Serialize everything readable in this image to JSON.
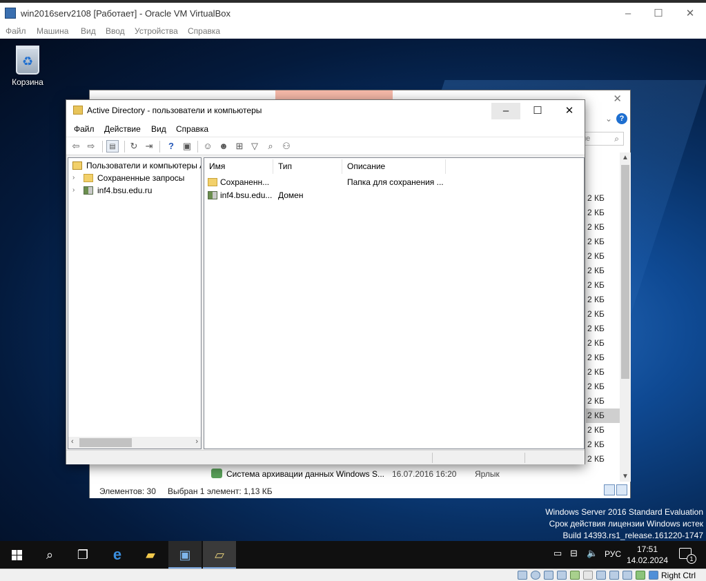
{
  "vbox": {
    "title": "win2016serv2108 [Работает] - Oracle VM VirtualBox",
    "menu": [
      "Файл",
      "Машина",
      "Вид",
      "Ввод",
      "Устройства",
      "Справка"
    ],
    "controls": {
      "minimize": "–",
      "maximize": "☐",
      "close": "✕"
    },
    "host_key": "Right Ctrl"
  },
  "desktop": {
    "recycle_bin_label": "Корзина"
  },
  "explorer_bg": {
    "search_placeholder": "ие",
    "sizes": [
      "2 КБ",
      "2 КБ",
      "2 КБ",
      "2 КБ",
      "2 КБ",
      "2 КБ",
      "2 КБ",
      "2 КБ",
      "2 КБ",
      "2 КБ",
      "2 КБ",
      "2 КБ",
      "2 КБ",
      "2 КБ",
      "2 КБ",
      "2 КБ",
      "2 КБ",
      "2 КБ",
      "2 КБ"
    ],
    "selected_size_index": 15,
    "visible_row": {
      "name": "Система архивации данных Windows S...",
      "date": "16.07.2016 16:20",
      "type": "Ярлык"
    },
    "status": {
      "count": "Элементов: 30",
      "selection": "Выбран 1 элемент: 1,13 КБ"
    }
  },
  "ad": {
    "title": "Active Directory - пользователи и компьютеры",
    "menu": [
      "Файл",
      "Действие",
      "Вид",
      "Справка"
    ],
    "tree": {
      "root": "Пользователи и компьютеры Active Directory",
      "children": [
        "Сохраненные запросы",
        "inf4.bsu.edu.ru"
      ]
    },
    "columns": [
      "Имя",
      "Тип",
      "Описание"
    ],
    "rows": [
      {
        "name": "Сохраненн...",
        "type": "",
        "description": "Папка для сохранения ...",
        "icon": "folder-icon"
      },
      {
        "name": "inf4.bsu.edu...",
        "type": "Домен",
        "description": "",
        "icon": "domain-icon"
      }
    ]
  },
  "watermark": {
    "line1": "Windows Server 2016 Standard Evaluation",
    "line2": "Срок действия лицензии Windows истек",
    "line3": "Build 14393.rs1_release.161220-1747"
  },
  "taskbar": {
    "language": "РУС",
    "time": "17:51",
    "date": "14.02.2024",
    "notification_count": "1"
  }
}
